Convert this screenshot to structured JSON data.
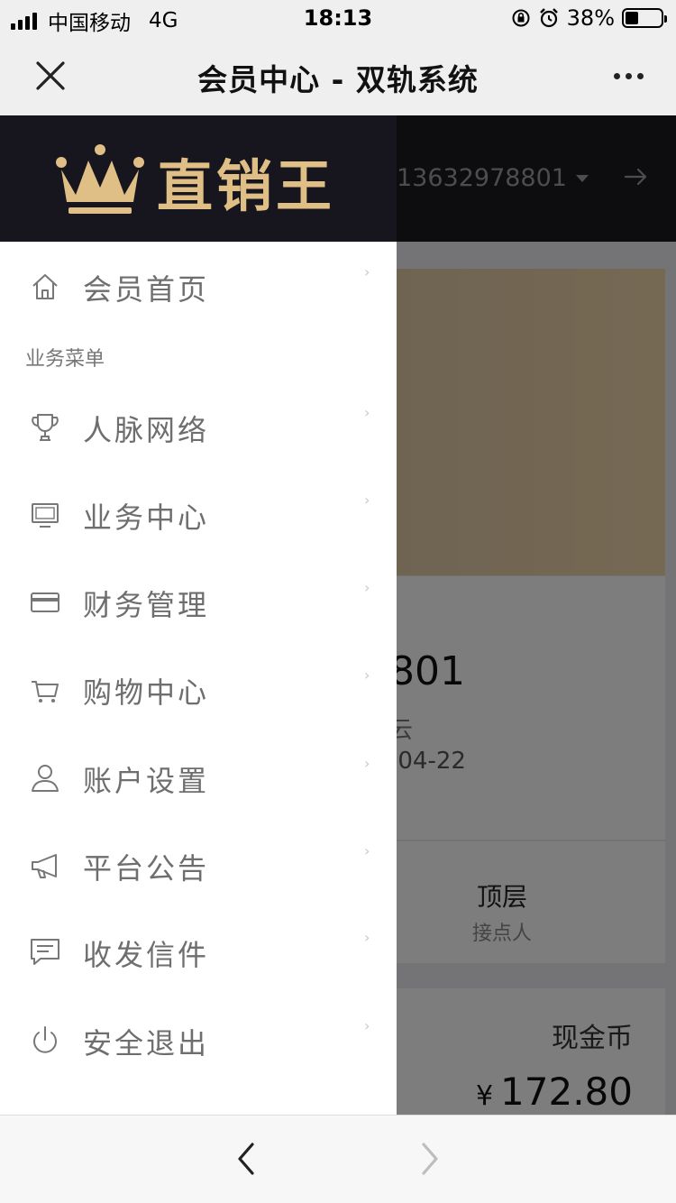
{
  "status_bar": {
    "carrier": "中国移动",
    "network": "4G",
    "time": "18:13",
    "battery": "38%",
    "battery_level": 0.38
  },
  "titlebar": {
    "title": "会员中心 - 双轨系统",
    "close_icon": "close-icon",
    "more_icon": "more-icon"
  },
  "drawer": {
    "brand": "直销王",
    "section_label": "业务菜单",
    "home": {
      "label": "会员首页",
      "icon": "home-icon"
    },
    "items": [
      {
        "label": "人脉网络",
        "icon": "trophy-icon"
      },
      {
        "label": "业务中心",
        "icon": "monitor-icon"
      },
      {
        "label": "财务管理",
        "icon": "card-icon"
      },
      {
        "label": "购物中心",
        "icon": "cart-icon"
      },
      {
        "label": "账户设置",
        "icon": "user-icon"
      },
      {
        "label": "平台公告",
        "icon": "megaphone-icon"
      },
      {
        "label": "收发信件",
        "icon": "message-icon"
      },
      {
        "label": "安全退出",
        "icon": "power-icon"
      }
    ],
    "chevron": "›"
  },
  "background": {
    "username": "13632978801",
    "member_id_partial": "801",
    "sub_partial": "云",
    "date_partial": "-04-22",
    "top_label": "顶层",
    "top_sub": "接点人",
    "cash_label": "现金币",
    "cash_currency": "¥",
    "cash_value": "172.80"
  },
  "colors": {
    "drawer_header": "#17151d",
    "brand_gold": "#e0bf86",
    "menu_text": "#6e6e6e"
  }
}
